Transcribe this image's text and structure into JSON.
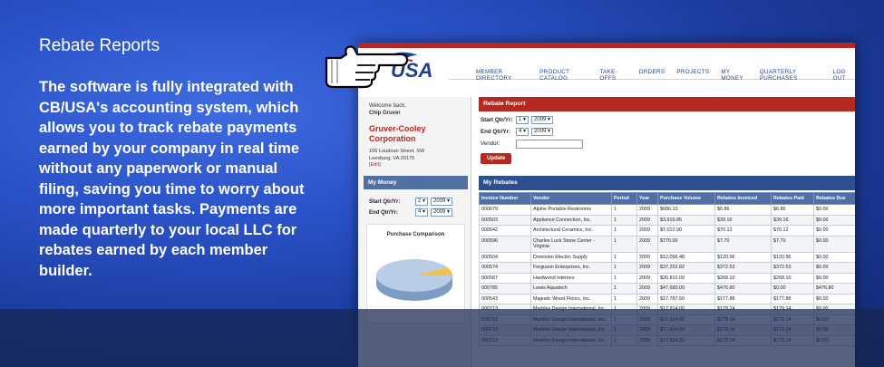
{
  "banner": {
    "title": "Rebate Reports",
    "body": "The software is fully integrated with CB/USA's accounting system, which allows you to track rebate payments earned by your company in real time without any paperwork or manual filing, saving you time to worry about more important tasks. Payments are made quarterly to your local LLC for rebates earned by each member builder."
  },
  "app": {
    "logo": "USA",
    "nav": [
      "MEMBER DIRECTORY",
      "PRODUCT CATALOG",
      "TAKE-OFFS",
      "ORDERS",
      "PROJECTS",
      "MY MONEY",
      "QUARTERLY PURCHASES",
      "LOG OUT"
    ]
  },
  "sidebar": {
    "welcome": "Welcome back,",
    "user": "Chip Gruver",
    "company": "Gruver-Cooley Corporation",
    "address1": "106 Loudoun Street, SW",
    "address2": "Leesburg, VA 20175",
    "edit": "[Edit]",
    "my_money": "My Money",
    "start_label": "Start Qtr/Yr:",
    "start_q": "2",
    "start_y": "2009",
    "end_label": "End Qtr/Yr:",
    "end_q": "4",
    "end_y": "2009",
    "chart_title": "Purchase Comparison"
  },
  "report": {
    "title": "Rebate Report",
    "start_label": "Start Qtr/Yr:",
    "start_q": "1",
    "start_y": "2009",
    "end_label": "End Qtr/Yr:",
    "end_q": "4",
    "end_y": "2009",
    "vendor_label": "Vendor:",
    "update": "Update"
  },
  "rebates": {
    "title": "My Rebates",
    "columns": [
      "Invoice Number",
      "Vendor",
      "Period",
      "Year",
      "Purchase Volume",
      "Rebates Invoiced",
      "Rebates Paid",
      "Rebates Due"
    ],
    "rows": [
      [
        "000679",
        "Alpine Portable Restrooms",
        "1",
        "2009",
        "$686.10",
        "$6.86",
        "$6.86",
        "$0.00"
      ],
      [
        "000503",
        "Appliance Connection, Inc.",
        "1",
        "2009",
        "$3,915.95",
        "$39.16",
        "$39.16",
        "$0.00"
      ],
      [
        "000642",
        "Architectural Ceramics, Inc.",
        "1",
        "2009",
        "$7,012.00",
        "$70.12",
        "$70.12",
        "$0.00"
      ],
      [
        "000596",
        "Charles Luck Stone Center - Virginia",
        "1",
        "2009",
        "$770.00",
        "$7.70",
        "$7.70",
        "$0.00"
      ],
      [
        "000504",
        "Dominion Electric Supply",
        "1",
        "2009",
        "$12,096.48",
        "$120.96",
        "$120.96",
        "$0.00"
      ],
      [
        "000574",
        "Ferguson Enterprises, Inc.",
        "1",
        "2009",
        "$37,252.82",
        "$372.53",
        "$372.53",
        "$0.00"
      ],
      [
        "000587",
        "Hardwood Interiors",
        "1",
        "2009",
        "$26,810.00",
        "$268.10",
        "$268.10",
        "$0.00"
      ],
      [
        "000785",
        "Lewis Aquatech",
        "1",
        "2009",
        "$47,680.00",
        "$476.80",
        "$0.00",
        "$476.80"
      ],
      [
        "000543",
        "Majestic Wood Floors, Inc.",
        "1",
        "2009",
        "$17,787.50",
        "$177.88",
        "$177.88",
        "$0.00"
      ],
      [
        "000713",
        "Marblex Design International, Inc.",
        "1",
        "2009",
        "$17,914.00",
        "$179.14",
        "$179.14",
        "$0.00"
      ],
      [
        "000713",
        "Marblex Design International, Inc.",
        "1",
        "2009",
        "$17,914.00",
        "$179.14",
        "$179.14",
        "$0.00"
      ],
      [
        "000713",
        "Marblex Design International, Inc.",
        "1",
        "2009",
        "$17,914.00",
        "$179.14",
        "$179.14",
        "$0.00"
      ],
      [
        "000713",
        "Marblex Design International, Inc.",
        "1",
        "2009",
        "$17,914.00",
        "$179.14",
        "$179.14",
        "$0.00"
      ]
    ]
  },
  "colors": {
    "brand_red": "#b42a22",
    "brand_blue": "#1d3f93",
    "header_blue": "#4f6fa5",
    "background": "#2a52c8"
  },
  "icons": {
    "pointer": "pointing-hand-icon",
    "logo": "eagle-logo-icon"
  }
}
